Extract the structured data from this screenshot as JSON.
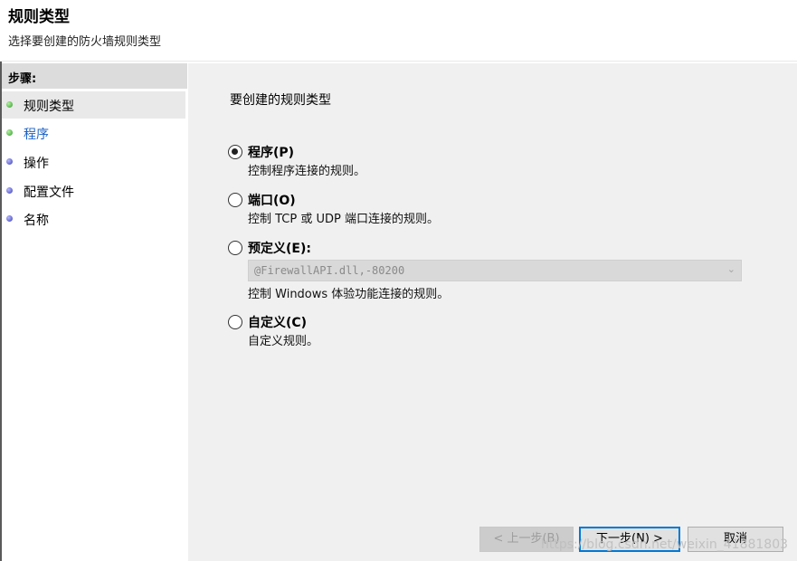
{
  "header": {
    "title": "规则类型",
    "subtitle": "选择要创建的防火墙规则类型"
  },
  "steps": {
    "heading": "步骤:",
    "items": [
      {
        "label": "规则类型",
        "status": "complete-current"
      },
      {
        "label": "程序",
        "status": "link"
      },
      {
        "label": "操作",
        "status": "pending"
      },
      {
        "label": "配置文件",
        "status": "pending"
      },
      {
        "label": "名称",
        "status": "pending"
      }
    ]
  },
  "content": {
    "prompt": "要创建的规则类型",
    "options": [
      {
        "label": "程序(P)",
        "description": "控制程序连接的规则。",
        "selected": true
      },
      {
        "label": "端口(O)",
        "description": "控制 TCP 或 UDP 端口连接的规则。",
        "selected": false
      },
      {
        "label": "预定义(E):",
        "description": "控制 Windows 体验功能连接的规则。",
        "selected": false
      },
      {
        "label": "自定义(C)",
        "description": "自定义规则。",
        "selected": false
      }
    ],
    "predefined_value": "@FirewallAPI.dll,-80200"
  },
  "buttons": {
    "back": "< 上一步(B)",
    "next": "下一步(N) >",
    "cancel": "取消"
  },
  "watermark": "https://blog.csdn.net/weixin_41881803",
  "colors": {
    "step_dot_green": "#2f9a2f",
    "step_dot_blue": "#3b3fb0",
    "link_text": "#1b62c5",
    "primary_border": "#0078d7",
    "content_bg": "#f0f0f0"
  }
}
